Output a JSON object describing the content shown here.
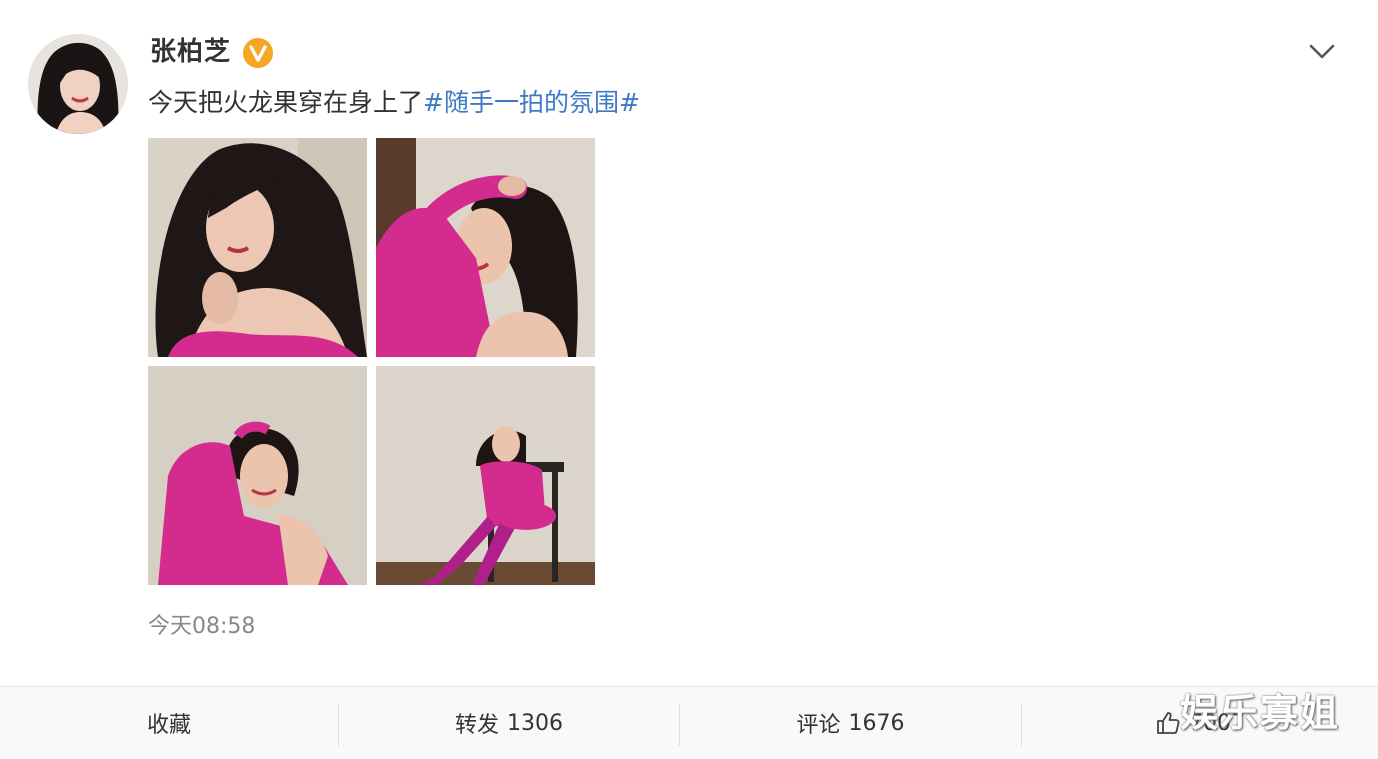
{
  "post": {
    "username": "张柏芝",
    "text": "今天把火龙果穿在身上了",
    "hashtag": "#随手一拍的氛围#",
    "timestamp": "今天08:58"
  },
  "icons": {
    "verified": "verified-badge-icon",
    "expand": "chevron-down-icon",
    "like": "thumbs-up-icon"
  },
  "colors": {
    "hashtag": "#3d79c6",
    "verified": "#f5a623",
    "sweater": "#d42c8e"
  },
  "actions": {
    "favorite_label": "收藏",
    "repost_label": "转发",
    "repost_count": "1306",
    "comment_label": "评论",
    "comment_count": "1676",
    "like_count": "7007"
  },
  "watermark": "娱乐寡姐"
}
